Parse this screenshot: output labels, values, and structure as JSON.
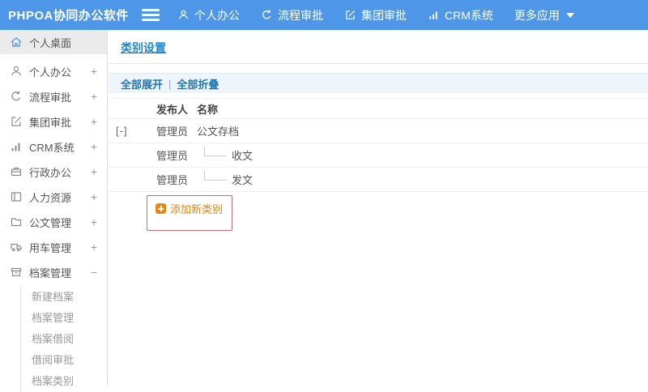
{
  "topbar": {
    "logo": "PHPOA协同办公软件",
    "nav": [
      {
        "label": "个人办公",
        "icon": "person-icon"
      },
      {
        "label": "流程审批",
        "icon": "process-icon"
      },
      {
        "label": "集团审批",
        "icon": "edit-icon"
      },
      {
        "label": "CRM系统",
        "icon": "chart-icon"
      },
      {
        "label": "更多应用",
        "icon": "caret-down-icon"
      }
    ]
  },
  "sidebar": {
    "items": [
      {
        "label": "个人桌面",
        "icon": "home-icon",
        "expand": "",
        "active": true
      },
      {
        "label": "个人办公",
        "icon": "person-icon",
        "expand": "+"
      },
      {
        "label": "流程审批",
        "icon": "process-icon",
        "expand": "+"
      },
      {
        "label": "集团审批",
        "icon": "edit-icon",
        "expand": "+"
      },
      {
        "label": "CRM系统",
        "icon": "chart-icon",
        "expand": "+"
      },
      {
        "label": "行政办公",
        "icon": "briefcase-icon",
        "expand": "+"
      },
      {
        "label": "人力资源",
        "icon": "book-icon",
        "expand": "+"
      },
      {
        "label": "公文管理",
        "icon": "folder-icon",
        "expand": "+"
      },
      {
        "label": "用车管理",
        "icon": "truck-icon",
        "expand": "+"
      },
      {
        "label": "档案管理",
        "icon": "archive-icon",
        "expand": "−"
      }
    ],
    "subitems": [
      {
        "label": "新建档案"
      },
      {
        "label": "档案管理"
      },
      {
        "label": "档案借阅"
      },
      {
        "label": "借阅审批"
      },
      {
        "label": "档案类别"
      }
    ]
  },
  "main": {
    "title": "类别设置",
    "toolbar": {
      "expand_all": "全部展开",
      "separator": "|",
      "collapse_all": "全部折叠"
    },
    "table": {
      "headers": {
        "publisher": "发布人",
        "name": "名称"
      },
      "rows": [
        {
          "expander": "[-]",
          "publisher": "管理员",
          "name": "公文存档"
        },
        {
          "expander": "",
          "publisher": "管理员",
          "name": "收文"
        },
        {
          "expander": "",
          "publisher": "管理员",
          "name": "发文"
        }
      ],
      "add_label": "添加新类别"
    }
  },
  "colors": {
    "topbar_bg": "#4e96e8",
    "title_blue": "#2288c8",
    "toolbar_bg": "#edf4fa",
    "toolbar_text": "#2277b5",
    "add_orange": "#e8820c",
    "annotation_red": "#c96c6c",
    "sidebar_active_bg": "#ebebeb"
  }
}
